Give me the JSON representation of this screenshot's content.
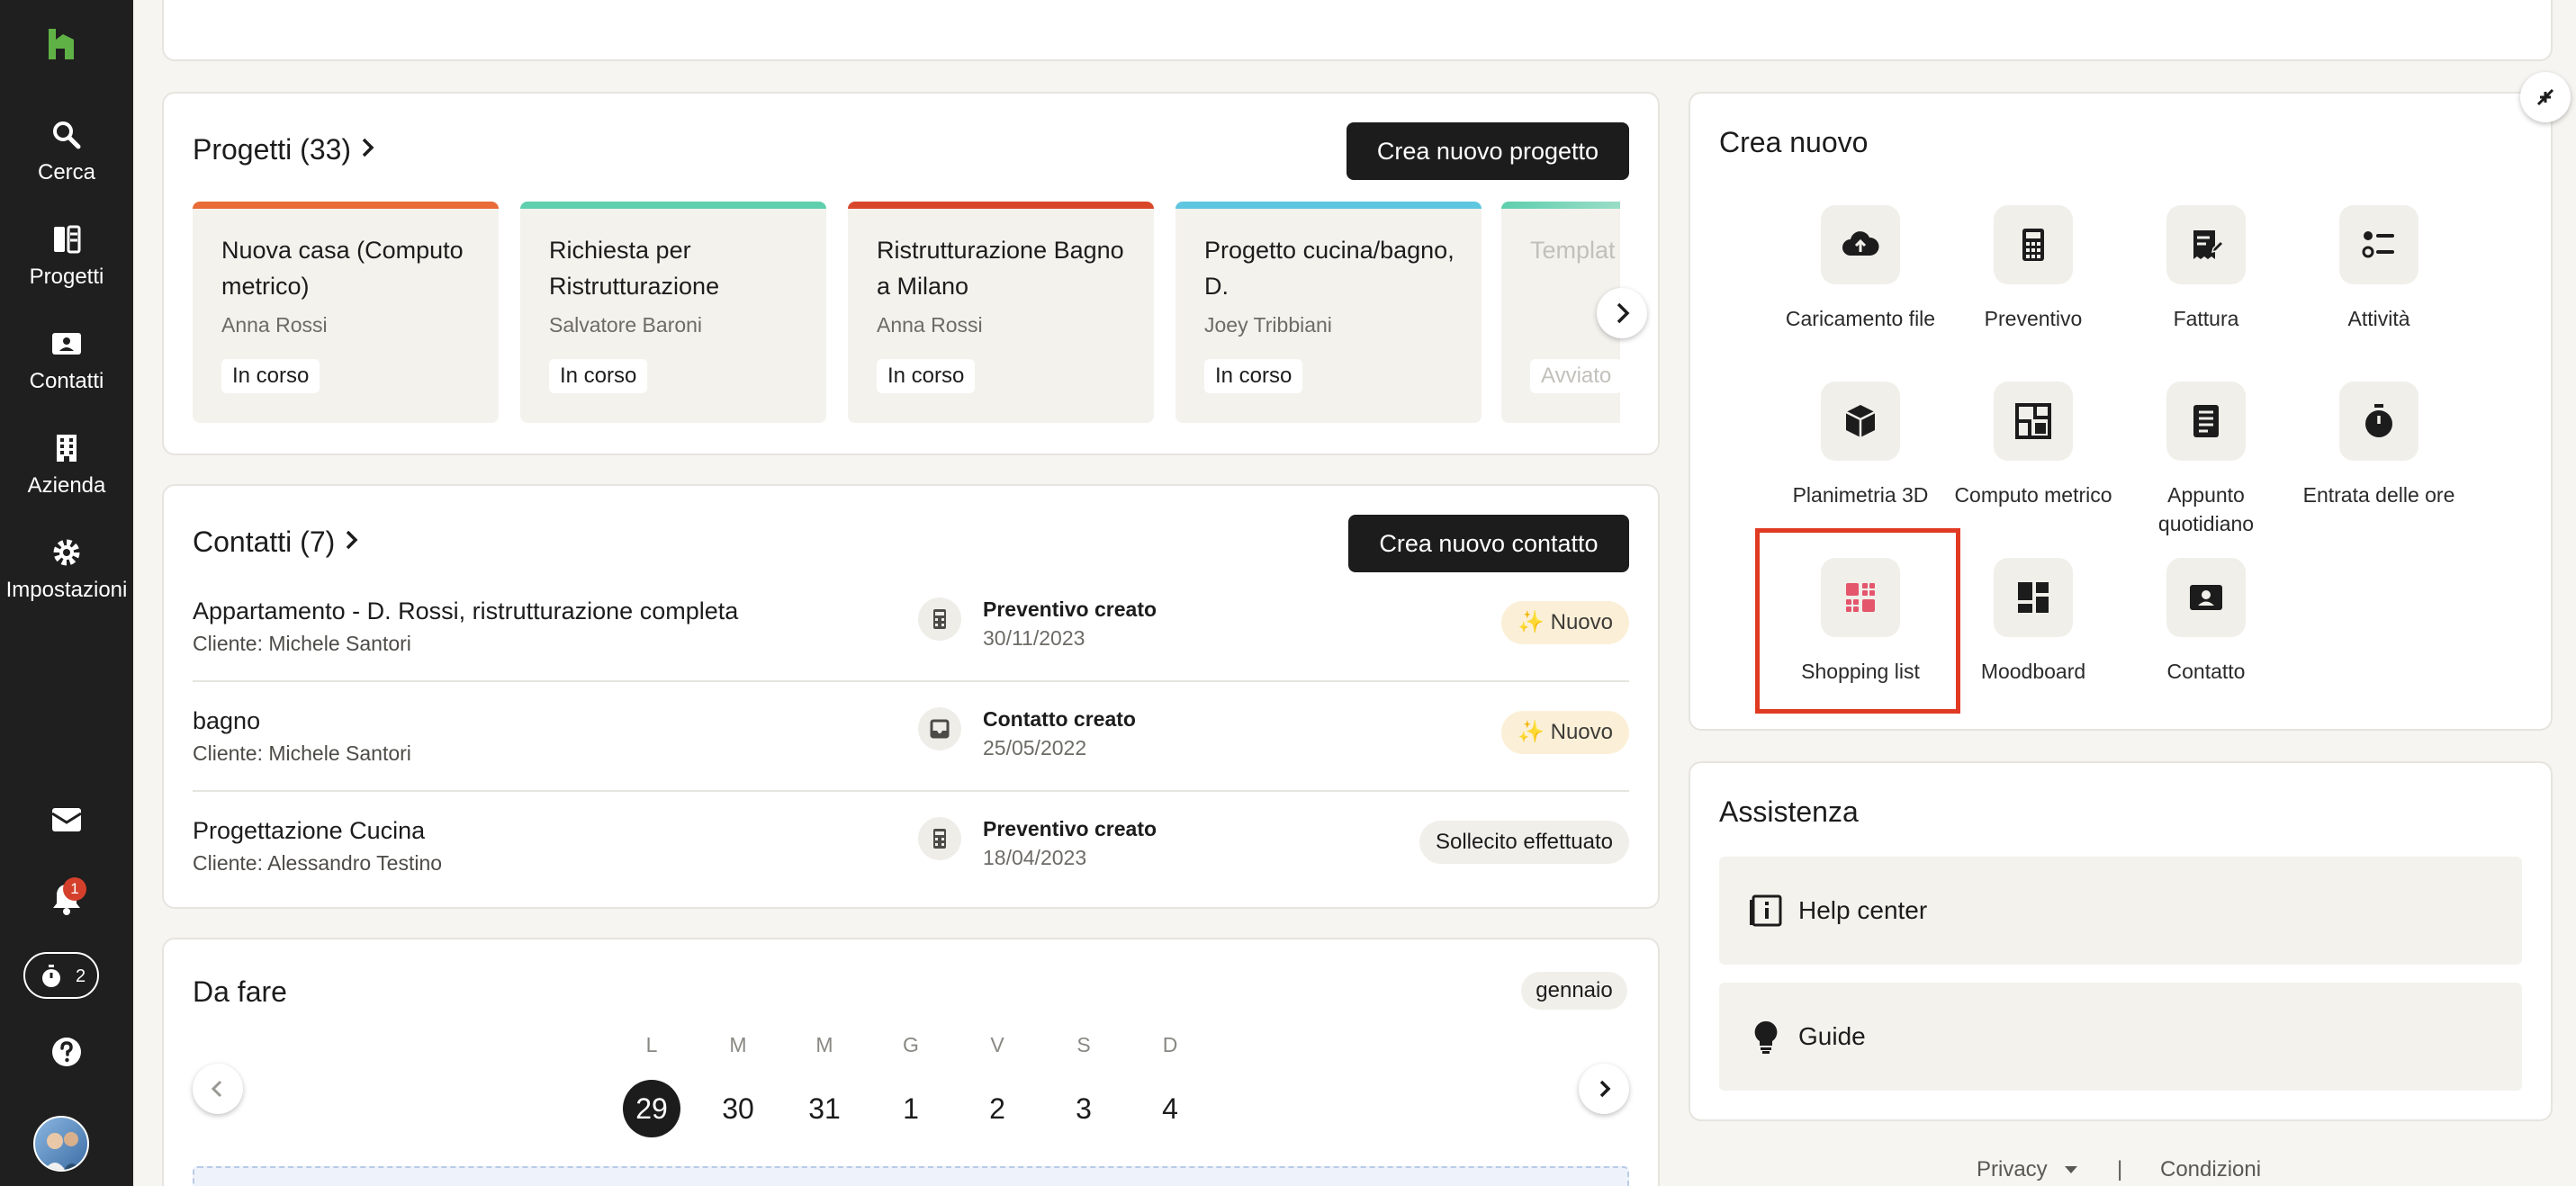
{
  "sidebar": {
    "items": [
      {
        "label": "Cerca",
        "icon": "search-icon"
      },
      {
        "label": "Progetti",
        "icon": "projects-icon"
      },
      {
        "label": "Contatti",
        "icon": "contacts-icon"
      },
      {
        "label": "Azienda",
        "icon": "building-icon"
      },
      {
        "label": "Impostazioni",
        "icon": "gear-icon"
      }
    ],
    "notifications_count": "1",
    "timer_count": "2"
  },
  "projects": {
    "title": "Progetti (33)",
    "create_label": "Crea nuovo progetto",
    "items": [
      {
        "title": "Nuova casa (Computo metrico)",
        "owner": "Anna Rossi",
        "status": "In corso",
        "color": "#e96b37"
      },
      {
        "title": "Richiesta per Ristrutturazione",
        "owner": "Salvatore Baroni",
        "status": "In corso",
        "color": "#5fcfae"
      },
      {
        "title": "Ristrutturazione Bagno a Milano",
        "owner": "Anna Rossi",
        "status": "In corso",
        "color": "#d9472b"
      },
      {
        "title": "Progetto cucina/bagno, D.",
        "owner": "Joey Tribbiani",
        "status": "In corso",
        "color": "#5fc6e0"
      },
      {
        "title": "Templat",
        "owner": "",
        "status": "Avviato",
        "color": "#5fcfae"
      }
    ]
  },
  "contacts": {
    "title": "Contatti (7)",
    "create_label": "Crea nuovo contatto",
    "rows": [
      {
        "name": "Appartamento - D. Rossi, ristrutturazione completa",
        "client": "Cliente: Michele Santori",
        "event": "Preventivo creato",
        "date": "30/11/2023",
        "tag": "Nuovo"
      },
      {
        "name": "bagno",
        "client": "Cliente: Michele Santori",
        "event": "Contatto creato",
        "date": "25/05/2022",
        "tag": "Nuovo"
      },
      {
        "name": "Progettazione Cucina",
        "client": "Cliente: Alessandro Testino",
        "event": "Preventivo creato",
        "date": "18/04/2023",
        "tag": "Sollecito effettuato"
      }
    ]
  },
  "todo": {
    "title": "Da fare",
    "month": "gennaio",
    "weekdays": [
      "L",
      "M",
      "M",
      "G",
      "V",
      "S",
      "D"
    ],
    "days": [
      "29",
      "30",
      "31",
      "1",
      "2",
      "3",
      "4"
    ],
    "selected_day": "29"
  },
  "create_new": {
    "title": "Crea nuovo",
    "items": [
      {
        "label": "Caricamento file",
        "icon": "cloud-upload-icon"
      },
      {
        "label": "Preventivo",
        "icon": "calculator-icon"
      },
      {
        "label": "Fattura",
        "icon": "invoice-icon"
      },
      {
        "label": "Attività",
        "icon": "task-list-icon"
      },
      {
        "label": "Planimetria 3D",
        "icon": "cube-icon"
      },
      {
        "label": "Computo metrico",
        "icon": "floorplan-icon"
      },
      {
        "label": "Appunto quotidiano",
        "icon": "notebook-icon"
      },
      {
        "label": "Entrata delle ore",
        "icon": "stopwatch-icon"
      },
      {
        "label": "Shopping list",
        "icon": "shopping-grid-icon"
      },
      {
        "label": "Moodboard",
        "icon": "moodboard-icon"
      },
      {
        "label": "Contatto",
        "icon": "contact-card-icon"
      }
    ]
  },
  "assist": {
    "title": "Assistenza",
    "help_center": "Help center",
    "guide": "Guide"
  },
  "footer": {
    "privacy": "Privacy",
    "separator": "|",
    "conditions": "Condizioni"
  },
  "colors": {
    "accent_green": "#5fb146",
    "sidebar_bg": "#1f1f1f",
    "highlight_red": "#e03a23",
    "shopping_pink": "#e4566c"
  }
}
